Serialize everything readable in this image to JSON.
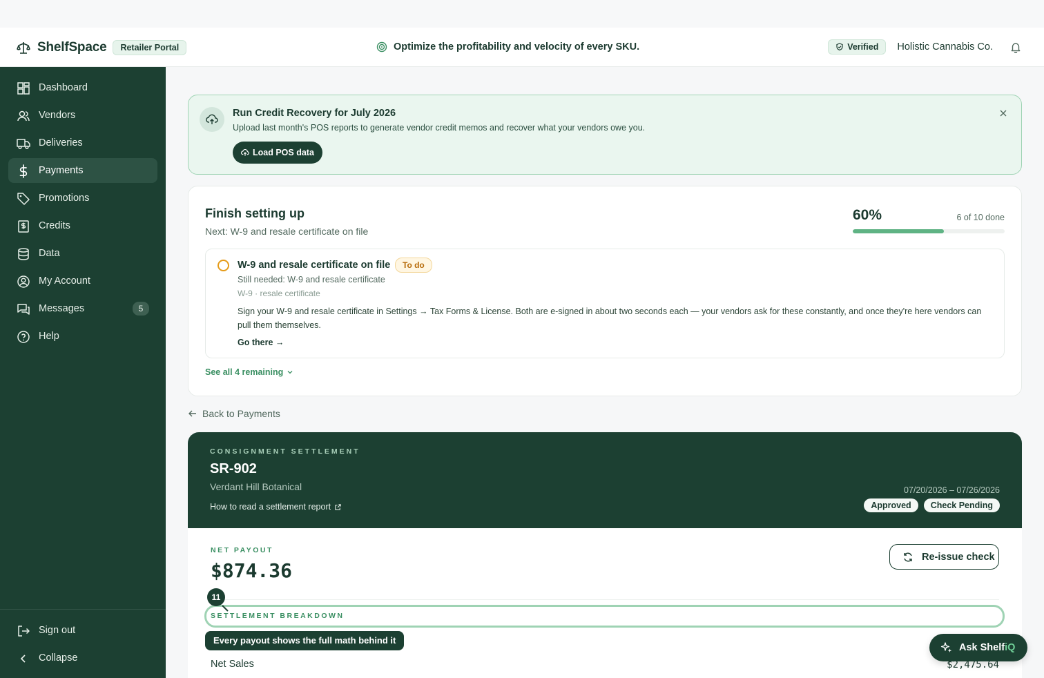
{
  "header": {
    "brand": "ShelfSpace",
    "portal_badge": "Retailer Portal",
    "tagline": "Optimize the profitability and velocity of every SKU.",
    "verified": "Verified",
    "company": "Holistic Cannabis Co."
  },
  "sidebar": {
    "items": [
      {
        "label": "Dashboard",
        "icon": "grid-icon"
      },
      {
        "label": "Vendors",
        "icon": "users-icon"
      },
      {
        "label": "Deliveries",
        "icon": "truck-icon"
      },
      {
        "label": "Payments",
        "icon": "dollar-icon",
        "active": true
      },
      {
        "label": "Promotions",
        "icon": "tag-icon"
      },
      {
        "label": "Credits",
        "icon": "receipt-icon"
      },
      {
        "label": "Data",
        "icon": "database-icon"
      },
      {
        "label": "My Account",
        "icon": "user-circle-icon"
      },
      {
        "label": "Messages",
        "icon": "messages-icon",
        "count": "5"
      },
      {
        "label": "Help",
        "icon": "help-icon"
      }
    ],
    "footer": [
      {
        "label": "Sign out",
        "icon": "sign-out-icon"
      },
      {
        "label": "Collapse",
        "icon": "chevron-left-icon"
      }
    ]
  },
  "banner": {
    "title": "Run Credit Recovery for July 2026",
    "subtitle": "Upload last month's POS reports to generate vendor credit memos and recover what your vendors owe you.",
    "button": "Load POS data"
  },
  "setup": {
    "title": "Finish setting up",
    "next": "Next: W-9 and resale certificate on file",
    "percent_label": "60%",
    "progress": 0.6,
    "done_text": "6 of 10 done",
    "task": {
      "title": "W-9 and resale certificate on file",
      "status": "To do",
      "needed": "Still needed: W-9 and resale certificate",
      "docs": "W-9 · resale certificate",
      "description": "Sign your W-9 and resale certificate in Settings → Tax Forms & License. Both are e-signed in about two seconds each — your vendors ask for these constantly, and once they're here vendors can pull them themselves.",
      "link": "Go there →"
    },
    "remaining": "See all 4 remaining"
  },
  "back_link": "Back to Payments",
  "settlement": {
    "kicker": "CONSIGNMENT SETTLEMENT",
    "id": "SR-902",
    "vendor": "Verdant Hill Botanical",
    "howto": "How to read a settlement report",
    "date_range": "07/20/2026 – 07/26/2026",
    "status_pills": [
      "Approved",
      "Check Pending"
    ],
    "net_payout_label": "NET PAYOUT",
    "net_payout": "$874.36",
    "reissue": "Re-issue check",
    "breakdown_label": "SETTLEMENT BREAKDOWN",
    "rows": [
      {
        "label": "Net Sales",
        "value": "$2,475.64"
      }
    ]
  },
  "tour": {
    "step": "11",
    "tip": "Every payout shows the full math behind it"
  },
  "assistant": {
    "label_prefix": "Ask Shelf",
    "label_accent": "iQ"
  },
  "colors": {
    "sidebar_bg": "#1c4032",
    "accent_green": "#3a8f62",
    "progress_fill": "#5fb384",
    "todo_orange": "#e59b18"
  }
}
